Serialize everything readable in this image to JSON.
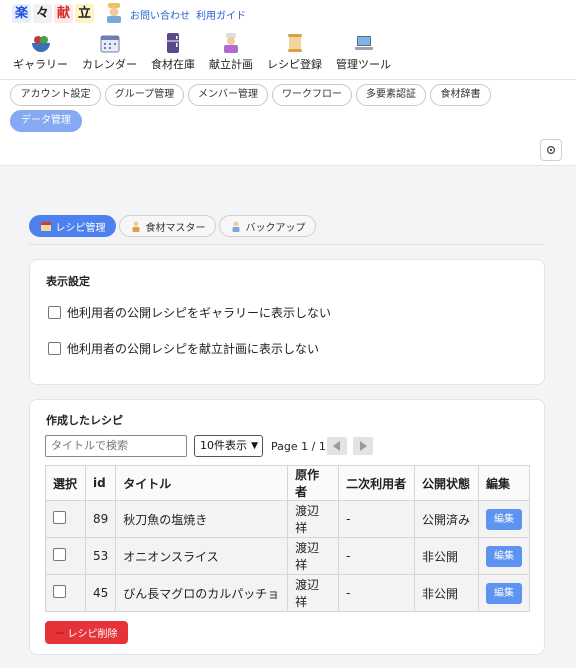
{
  "header": {
    "logo_chars": [
      "楽",
      "々",
      "献",
      "立"
    ],
    "links": [
      "お問い合わせ",
      "利用ガイド"
    ],
    "nav": [
      {
        "label": "ギャラリー",
        "icon": "salad-bowl-icon"
      },
      {
        "label": "カレンダー",
        "icon": "calendar-icon"
      },
      {
        "label": "食材在庫",
        "icon": "fridge-icon"
      },
      {
        "label": "献立計画",
        "icon": "cook-icon"
      },
      {
        "label": "レシピ登録",
        "icon": "scroll-icon"
      },
      {
        "label": "管理ツール",
        "icon": "laptop-icon"
      }
    ]
  },
  "subnav": {
    "chips": [
      "アカウント設定",
      "グループ管理",
      "メンバー管理",
      "ワークフロー",
      "多要素認証",
      "食材辞書",
      "データ管理"
    ],
    "active": "データ管理",
    "settings_icon": "gear-icon"
  },
  "tabs": [
    {
      "label": "レシピ管理",
      "icon": "recipe-icon",
      "active": true
    },
    {
      "label": "食材マスター",
      "icon": "ingredient-icon",
      "active": false
    },
    {
      "label": "バックアップ",
      "icon": "backup-icon",
      "active": false
    }
  ],
  "display_settings": {
    "title": "表示設定",
    "options": [
      {
        "label": "他利用者の公開レシピをギャラリーに表示しない",
        "checked": false
      },
      {
        "label": "他利用者の公開レシピを献立計画に表示しない",
        "checked": false
      }
    ]
  },
  "recipes": {
    "title": "作成したレシピ",
    "search_placeholder": "タイトルで検索",
    "per_page": "10件表示",
    "page_info": "Page 1 / 1",
    "columns": [
      "選択",
      "id",
      "タイトル",
      "原作者",
      "二次利用者",
      "公開状態",
      "編集"
    ],
    "rows": [
      {
        "id": "89",
        "title": "秋刀魚の塩焼き",
        "author": "渡辺祥",
        "secondary": "-",
        "status": "公開済み",
        "edit": "編集"
      },
      {
        "id": "53",
        "title": "オニオンスライス",
        "author": "渡辺祥",
        "secondary": "-",
        "status": "非公開",
        "edit": "編集"
      },
      {
        "id": "45",
        "title": "びん長マグロのカルパッチョ",
        "author": "渡辺祥",
        "secondary": "-",
        "status": "非公開",
        "edit": "編集"
      }
    ],
    "delete_label": "レシピ削除"
  },
  "colors": {
    "accent": "#4d82ee",
    "danger": "#e6333a",
    "link": "#2a62d4"
  }
}
